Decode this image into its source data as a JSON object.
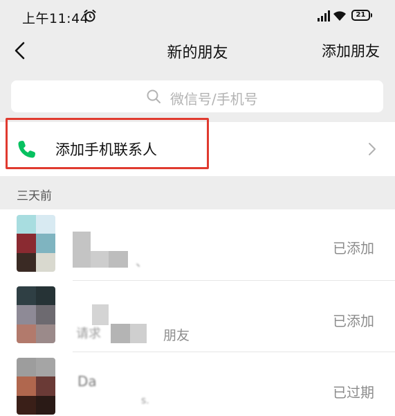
{
  "status_bar": {
    "time": "上午11:44",
    "battery": "21"
  },
  "nav": {
    "title": "新的朋友",
    "action": "添加朋友"
  },
  "search": {
    "placeholder": "微信号/手机号"
  },
  "add_contact": {
    "label": "添加手机联系人"
  },
  "section": {
    "label": "三天前"
  },
  "friends": [
    {
      "partial_text": "、",
      "status": "已添加"
    },
    {
      "partial_text": "请求",
      "partial_text_2": "朋友",
      "status": "已添加"
    },
    {
      "partial_text": "Da",
      "partial_text_2": "s.",
      "status": "已过期"
    }
  ],
  "colors": {
    "highlight": "#e03a2f",
    "phone_icon": "#07c160",
    "background": "#ededed"
  },
  "icons": [
    "alarm-icon",
    "signal-icon",
    "wifi-icon",
    "back-icon",
    "search-icon",
    "phone-icon",
    "chevron-right-icon"
  ]
}
